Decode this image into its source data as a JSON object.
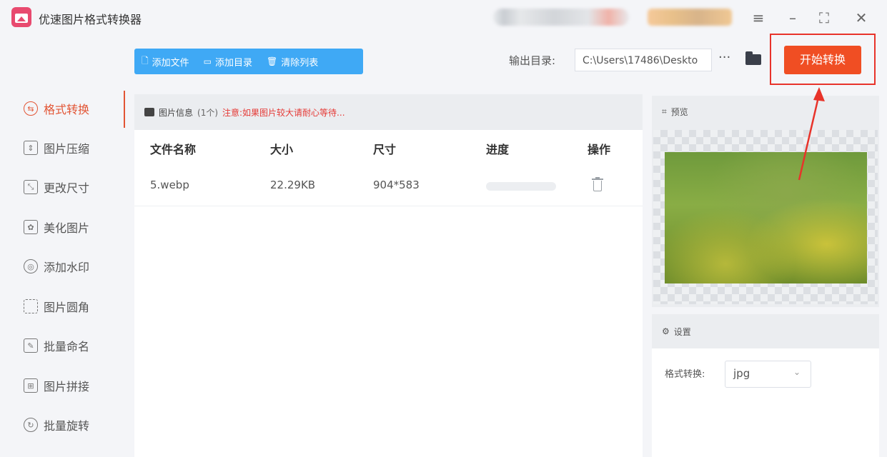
{
  "app": {
    "title": "优速图片格式转换器"
  },
  "toolbar": {
    "add_file": "添加文件",
    "add_folder": "添加目录",
    "clear_list": "清除列表",
    "output_label": "输出目录:",
    "output_path": "C:\\Users\\17486\\Deskto",
    "more": "···",
    "start": "开始转换"
  },
  "sidebar": {
    "items": [
      {
        "label": "格式转换",
        "icon": "swap-icon",
        "active": true
      },
      {
        "label": "图片压缩",
        "icon": "compress-icon"
      },
      {
        "label": "更改尺寸",
        "icon": "resize-icon"
      },
      {
        "label": "美化图片",
        "icon": "beautify-icon"
      },
      {
        "label": "添加水印",
        "icon": "watermark-icon"
      },
      {
        "label": "图片圆角",
        "icon": "round-corner-icon"
      },
      {
        "label": "批量命名",
        "icon": "rename-icon"
      },
      {
        "label": "图片拼接",
        "icon": "stitch-icon"
      },
      {
        "label": "批量旋转",
        "icon": "rotate-icon"
      }
    ]
  },
  "file_panel": {
    "info_label": "图片信息",
    "info_count": "(1个)",
    "info_note": "注意:如果图片较大请耐心等待...",
    "columns": [
      "文件名称",
      "大小",
      "尺寸",
      "进度",
      "操作"
    ],
    "rows": [
      {
        "name": "5.webp",
        "size": "22.29KB",
        "dimensions": "904*583",
        "progress": 0
      }
    ]
  },
  "preview": {
    "title": "预览"
  },
  "settings": {
    "title": "设置",
    "format_label": "格式转换:",
    "format_value": "jpg"
  },
  "colors": {
    "accent": "#3fa9f5",
    "start_button": "#f04e23",
    "active": "#e25535",
    "highlight": "#e8332a"
  }
}
